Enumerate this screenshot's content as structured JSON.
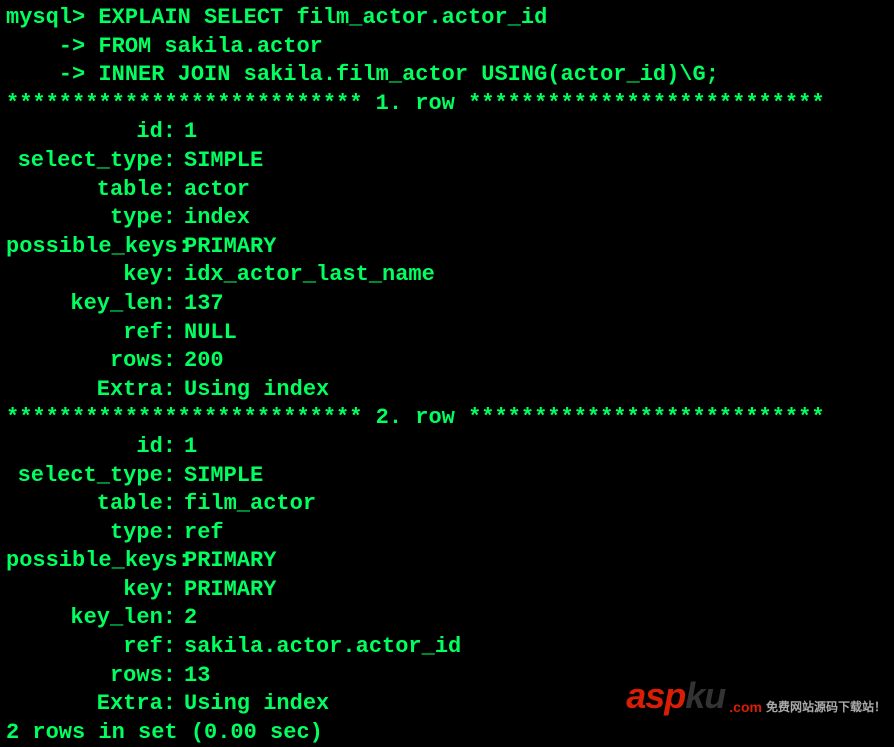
{
  "prompt": {
    "line1": "mysql> EXPLAIN SELECT film_actor.actor_id",
    "line2": "    -> FROM sakila.actor",
    "line3": "    -> INNER JOIN sakila.film_actor USING(actor_id)\\G;"
  },
  "separators": {
    "row1": "*************************** 1. row ***************************",
    "row2": "*************************** 2. row ***************************"
  },
  "rows": [
    {
      "id": "1",
      "select_type": "SIMPLE",
      "table": "actor",
      "type": "index",
      "possible_keys": "PRIMARY",
      "key": "idx_actor_last_name",
      "key_len": "137",
      "ref": "NULL",
      "rows": "200",
      "Extra": "Using index"
    },
    {
      "id": "1",
      "select_type": "SIMPLE",
      "table": "film_actor",
      "type": "ref",
      "possible_keys": "PRIMARY",
      "key": "PRIMARY",
      "key_len": "2",
      "ref": "sakila.actor.actor_id",
      "rows": "13",
      "Extra": "Using index"
    }
  ],
  "labels": {
    "id": "id:",
    "select_type": "select_type:",
    "table": "table:",
    "type": "type:",
    "possible_keys": "possible_keys:",
    "key": "key:",
    "key_len": "key_len:",
    "ref": "ref:",
    "rows": "rows:",
    "Extra": "Extra:"
  },
  "footer": "2 rows in set (0.00 sec)",
  "watermark": {
    "logo_red": "asp",
    "logo_black": "ku",
    "com": ".com",
    "sub": "免费网站源码下载站！"
  }
}
